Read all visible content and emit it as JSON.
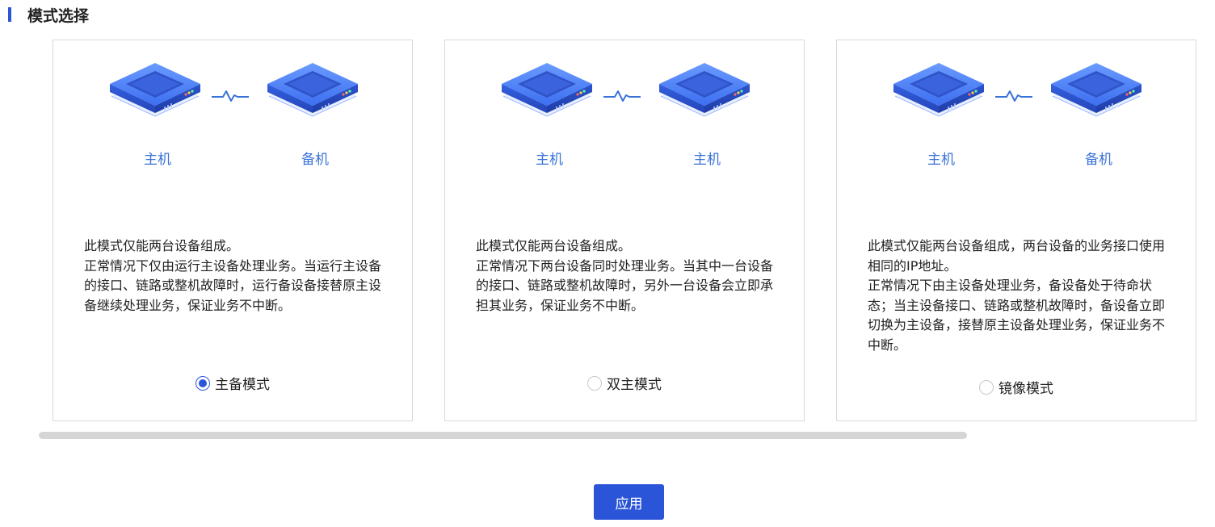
{
  "section": {
    "title": "模式选择"
  },
  "colors": {
    "accent": "#2b55d9",
    "device_label": "#3a73d8"
  },
  "cards": [
    {
      "left_device": "主机",
      "right_device": "备机",
      "description": [
        "此模式仅能两台设备组成。",
        "正常情况下仅由运行主设备处理业务。当运行主设备的接口、链路或整机故障时，运行备设备接替原主设备继续处理业务，保证业务不中断。"
      ],
      "mode_label": "主备模式",
      "selected": true
    },
    {
      "left_device": "主机",
      "right_device": "主机",
      "description": [
        "此模式仅能两台设备组成。",
        "正常情况下两台设备同时处理业务。当其中一台设备的接口、链路或整机故障时，另外一台设备会立即承担其业务，保证业务不中断。"
      ],
      "mode_label": "双主模式",
      "selected": false
    },
    {
      "left_device": "主机",
      "right_device": "备机",
      "description": [
        "此模式仅能两台设备组成，两台设备的业务接口使用相同的IP地址。",
        "正常情况下由主设备处理业务，备设备处于待命状态；当主设备接口、链路或整机故障时，备设备立即切换为主设备，接替原主设备处理业务，保证业务不中断。"
      ],
      "mode_label": "镜像模式",
      "selected": false
    }
  ],
  "icons": {
    "device": "server-device-icon",
    "link": "heartbeat-link-icon",
    "radio_on": "radio-checked-icon",
    "radio_off": "radio-unchecked-icon"
  },
  "footer": {
    "apply_label": "应用"
  }
}
